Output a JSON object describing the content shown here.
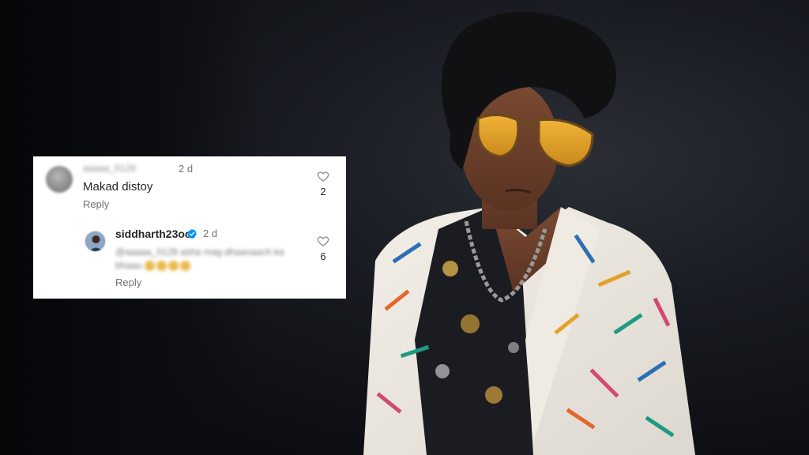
{
  "comments": [
    {
      "blurred_username": "aaaaa_0128",
      "time": "2 d",
      "text": "Makad distoy",
      "reply_label": "Reply",
      "likes": "2"
    },
    {
      "username": "siddharth23oct",
      "verified": true,
      "time": "2 d",
      "blurred_text": "@aaaaa_0128 asha mag dhaanaach ka bhaau",
      "reply_label": "Reply",
      "likes": "6"
    }
  ],
  "icons": {
    "like": "heart-outline-icon",
    "verified": "verified-badge-icon"
  },
  "colors": {
    "card_background": "#ffffff",
    "text_primary": "#262626",
    "text_secondary": "#737373",
    "verified_blue": "#0095f6",
    "background_dark": "#0c0e12"
  }
}
